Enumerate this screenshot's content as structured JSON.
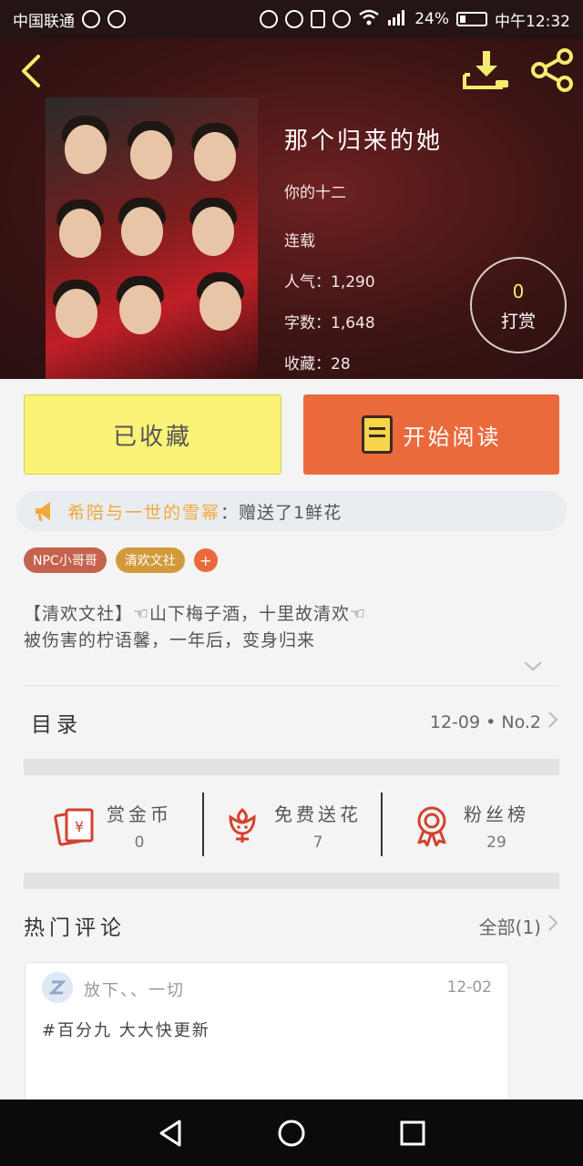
{
  "status_bar": {
    "carrier": "中国联通",
    "battery": "24%",
    "time": "中午12:32"
  },
  "book": {
    "title": "那个归来的她",
    "author": "你的十二",
    "status": "连载",
    "popularity": "人气：1,290",
    "word_count": "字数：1,648",
    "favorites": "收藏：28"
  },
  "reward": {
    "count": "0",
    "label": "打赏"
  },
  "actions": {
    "collected_label": "已收藏",
    "read_label": "开始阅读"
  },
  "gift_banner": {
    "user": "希陪与一世的雪幂",
    "text": "：赠送了1鲜花"
  },
  "tags": [
    "NPC小哥哥",
    "清欢文社"
  ],
  "tag_add": "+",
  "description": {
    "line1": "【清欢文社】☜山下梅子酒，十里故清欢☜",
    "line2": "被伤害的柠语馨，一年后，变身归来"
  },
  "toc": {
    "label": "目录",
    "latest": "12-09 • No.2"
  },
  "stats": {
    "coins": {
      "label": "赏金币",
      "value": "0",
      "icon": "red-envelope-icon"
    },
    "flowers": {
      "label": "免费送花",
      "value": "7",
      "icon": "flower-icon"
    },
    "fans": {
      "label": "粉丝榜",
      "value": "29",
      "icon": "medal-icon"
    }
  },
  "comments": {
    "title": "热门评论",
    "all_label": "全部(1)",
    "items": [
      {
        "user": "放下、、一切",
        "date": "12-02",
        "text": "#百分九 大大快更新"
      }
    ]
  },
  "colors": {
    "accent": "#ea6a3c",
    "yellow": "#fbf278",
    "gold": "#f3ec70"
  }
}
